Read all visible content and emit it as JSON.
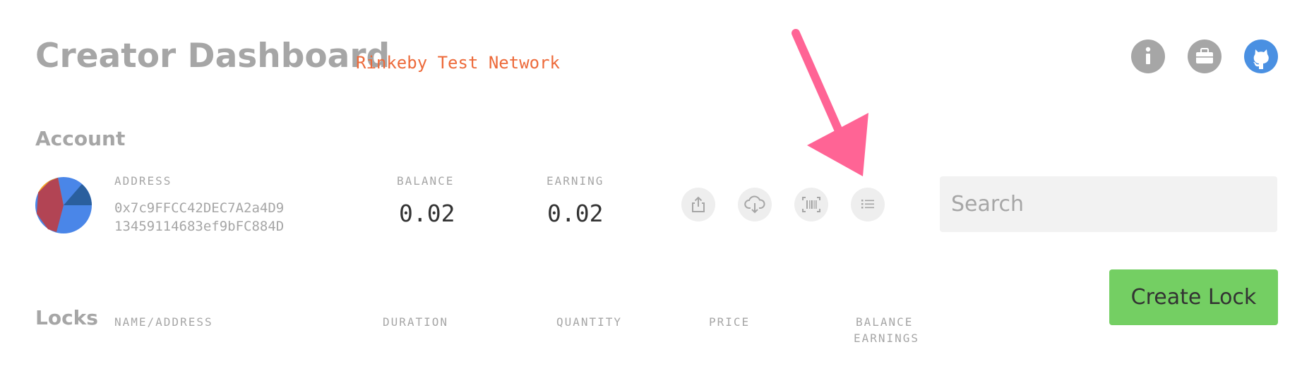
{
  "header": {
    "title": "Creator Dashboard",
    "network": "Rinkeby Test Network",
    "icons": [
      "info-icon",
      "briefcase-icon",
      "github-icon"
    ]
  },
  "account": {
    "section_title": "Account",
    "address_label": "ADDRESS",
    "address_line1": "0x7c9FFCC42DEC7A2a4D9",
    "address_line2": "13459114683ef9bFC884D",
    "balance_label": "BALANCE",
    "balance_value": "0.02",
    "earning_label": "EARNING",
    "earning_value": "0.02",
    "actions": [
      "export-icon",
      "cloud-download-icon",
      "barcode-icon",
      "list-icon"
    ]
  },
  "search": {
    "placeholder": "Search"
  },
  "create_lock": {
    "label": "Create Lock"
  },
  "locks": {
    "section_title": "Locks",
    "columns": {
      "name": "NAME/ADDRESS",
      "duration": "DURATION",
      "quantity": "QUANTITY",
      "price": "PRICE",
      "balance": "BALANCE",
      "earnings": "EARNINGS"
    }
  },
  "colors": {
    "accent_network": "#ed6a3a",
    "github": "#4a90e2",
    "create_button": "#74cf63",
    "annotation_arrow": "#ff6495"
  }
}
